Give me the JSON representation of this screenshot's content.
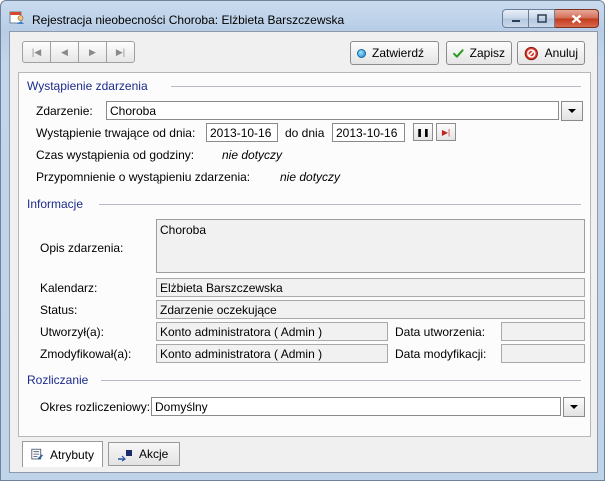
{
  "window": {
    "title": "Rejestracja nieobecności Choroba:  Elżbieta Barszczewska"
  },
  "toolbar": {
    "confirm_label": "Zatwierdź",
    "save_label": "Zapisz",
    "cancel_label": "Anuluj"
  },
  "occurrence": {
    "section_title": "Wystąpienie zdarzenia",
    "event_label": "Zdarzenie:",
    "event_value": "Choroba",
    "from_label": "Wystąpienie trwające od dnia:",
    "from_value": "2013-10-16",
    "to_label": "do dnia",
    "to_value": "2013-10-16",
    "time_label": "Czas wystąpienia od godziny:",
    "time_value": "nie dotyczy",
    "reminder_label": "Przypomnienie o wystąpieniu zdarzenia:",
    "reminder_value": "nie dotyczy"
  },
  "info": {
    "section_title": "Informacje",
    "description_label": "Opis zdarzenia:",
    "description_value": "Choroba",
    "calendar_label": "Kalendarz:",
    "calendar_value": "Elżbieta Barszczewska",
    "status_label": "Status:",
    "status_value": "Zdarzenie oczekujące",
    "created_by_label": "Utworzył(a):",
    "created_by_value": "Konto administratora ( Admin )",
    "created_date_label": "Data utworzenia:",
    "created_date_value": "",
    "modified_by_label": "Zmodyfikował(a):",
    "modified_by_value": "Konto administratora ( Admin )",
    "modified_date_label": "Data modyfikacji:",
    "modified_date_value": ""
  },
  "settlement": {
    "section_title": "Rozliczanie",
    "period_label": "Okres rozliczeniowy:",
    "period_value": "Domyślny"
  },
  "tabs": [
    {
      "label": "Atrybuty"
    },
    {
      "label": "Akcje"
    }
  ],
  "colors": {
    "section_title": "#1c2b8c",
    "save_icon": "#2a9a1e",
    "cancel_icon": "#c8261e",
    "confirm_icon": "#1e88d4"
  }
}
